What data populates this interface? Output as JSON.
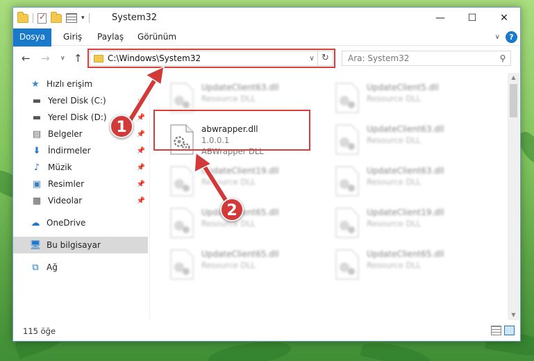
{
  "title_bar": {
    "title": "System32",
    "minimize": "—",
    "maximize": "☐",
    "close": "✕"
  },
  "ribbon": {
    "tabs": [
      "Dosya",
      "Giriş",
      "Paylaş",
      "Görünüm"
    ],
    "help": "?"
  },
  "address_bar": {
    "path": "C:\\Windows\\System32",
    "refresh": "↻"
  },
  "search": {
    "placeholder": "Ara: System32"
  },
  "sidebar": {
    "items": [
      {
        "label": "Hızlı erişim",
        "icon": "star-icon"
      },
      {
        "label": "Yerel Disk (C:)",
        "icon": "drive-icon",
        "pinned": true
      },
      {
        "label": "Yerel Disk (D:)",
        "icon": "drive-icon",
        "pinned": true
      },
      {
        "label": "Belgeler",
        "icon": "documents-icon",
        "pinned": true
      },
      {
        "label": "İndirmeler",
        "icon": "downloads-icon",
        "pinned": true
      },
      {
        "label": "Müzik",
        "icon": "music-icon",
        "pinned": true
      },
      {
        "label": "Resimler",
        "icon": "pictures-icon",
        "pinned": true
      },
      {
        "label": "Videolar",
        "icon": "videos-icon",
        "pinned": true
      },
      {
        "label": "OneDrive",
        "icon": "cloud-icon"
      },
      {
        "label": "Bu bilgisayar",
        "icon": "computer-icon",
        "selected": true
      },
      {
        "label": "Ağ",
        "icon": "network-icon"
      }
    ]
  },
  "files": {
    "highlighted": {
      "name": "abwrapper.dll",
      "version": "1.0.0.1",
      "description": "ABWrapper DLL"
    },
    "background": [
      {
        "name": "UpdateClient63.dll",
        "description": "Resource DLL"
      },
      {
        "name": "UpdateClient5.dll",
        "description": "Resource DLL"
      },
      {
        "name": "UpdateClient63.dll",
        "description": "Resource DLL"
      },
      {
        "name": "UpdateClient19.dll",
        "description": "Resource DLL"
      },
      {
        "name": "UpdateClient63.dll",
        "description": "Resource DLL"
      },
      {
        "name": "UpdateClient65.dll",
        "description": "Resource DLL"
      },
      {
        "name": "UpdateClient19.dll",
        "description": "Resource DLL"
      },
      {
        "name": "UpdateClient65.dll",
        "description": "Resource DLL"
      },
      {
        "name": "UpdateClient65.dll",
        "description": "Resource DLL"
      }
    ]
  },
  "status": {
    "item_count": "115 öğe"
  },
  "annotations": {
    "step1": "1",
    "step2": "2",
    "color": "#d23a3a"
  }
}
